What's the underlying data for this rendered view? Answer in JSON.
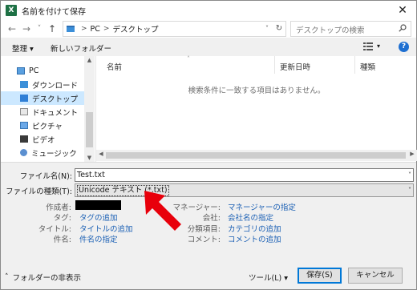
{
  "window": {
    "title": "名前を付けて保存",
    "app_icon": "X",
    "close_glyph": "✕"
  },
  "nav": {
    "back_glyph": "←",
    "forward_glyph": "→",
    "dropdown_glyph": "˅",
    "up_glyph": "↑",
    "breadcrumb": [
      "PC",
      "デスクトップ"
    ],
    "breadcrumb_sep": ">",
    "search_placeholder": "デスクトップの検索"
  },
  "toolbar": {
    "organize": "整理 ▾",
    "new_folder": "新しいフォルダー",
    "help": "?"
  },
  "sidebar": {
    "items": [
      {
        "label": "PC",
        "icon": "pc-icon"
      },
      {
        "label": "ダウンロード",
        "icon": "download-folder-icon"
      },
      {
        "label": "デスクトップ",
        "icon": "desktop-folder-icon",
        "selected": true
      },
      {
        "label": "ドキュメント",
        "icon": "documents-folder-icon"
      },
      {
        "label": "ピクチャ",
        "icon": "pictures-folder-icon"
      },
      {
        "label": "ビデオ",
        "icon": "videos-folder-icon"
      },
      {
        "label": "ミュージック",
        "icon": "music-folder-icon"
      }
    ]
  },
  "filelist": {
    "columns": [
      "名前",
      "更新日時",
      "種類"
    ],
    "empty_message": "検索条件に一致する項目はありません。"
  },
  "form": {
    "filename_label": "ファイル名(N):",
    "filename_value": "Test.txt",
    "filetype_label": "ファイルの種類(T):",
    "filetype_value": "Unicode テキスト (*.txt)",
    "author_label": "作成者:",
    "tags_label": "タグ:",
    "tags_link": "タグの追加",
    "title_label": "タイトル:",
    "title_link": "タイトルの追加",
    "subject_label": "件名:",
    "subject_link": "件名の指定",
    "manager_label": "マネージャー:",
    "manager_link": "マネージャーの指定",
    "company_label": "会社:",
    "company_link": "会社名の指定",
    "category_label": "分類項目:",
    "category_link": "カテゴリの追加",
    "comment_label": "コメント:",
    "comment_link": "コメントの追加"
  },
  "footer": {
    "hide_folders": "フォルダーの非表示",
    "tools": "ツール(L) ▾",
    "save": "保存(S)",
    "cancel": "キャンセル"
  },
  "colors": {
    "accent": "#0078d7",
    "link": "#1a5fb4",
    "selection": "#cce8ff",
    "arrow": "#e8000b"
  }
}
